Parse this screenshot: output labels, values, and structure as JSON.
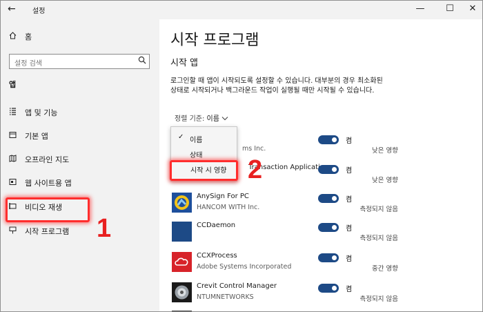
{
  "window": {
    "title": "설정",
    "back_icon": "back-arrow-icon",
    "controls": [
      "minimize-icon",
      "maximize-icon",
      "close-icon"
    ],
    "min_glyph": "—",
    "max_glyph": "☐",
    "close_glyph": "✕",
    "back_glyph": "←"
  },
  "sidebar": {
    "home": "홈",
    "search_placeholder": "설정 검색",
    "section": "앱",
    "items": [
      {
        "label": "앱 및 기능",
        "icon": "apps-list-icon"
      },
      {
        "label": "기본 앱",
        "icon": "default-apps-icon"
      },
      {
        "label": "오프라인 지도",
        "icon": "offline-maps-icon"
      },
      {
        "label": "웹 사이트용 앱",
        "icon": "websites-apps-icon"
      },
      {
        "label": "비디오 재생",
        "icon": "video-playback-icon"
      },
      {
        "label": "시작 프로그램",
        "icon": "startup-icon"
      }
    ]
  },
  "annotations": {
    "step1": "1",
    "step2": "2",
    "highlight_color": "#ff2d2d"
  },
  "main": {
    "title": "시작 프로그램",
    "subtitle": "시작 앱",
    "description": "로그인할 때 앱이 시작되도록 설정할 수 있습니다. 대부분의 경우 최소화된 상태로 시작되거나 백그라운드 작업이 실행될 때만 시작될 수 있습니다.",
    "sort_label": "정렬 기준:",
    "sort_value": "이름",
    "sort_menu": [
      "이름",
      "상태",
      "시작 시 영향"
    ],
    "sort_checked": "이름",
    "apps": [
      {
        "name": "",
        "publisher": "ms Inc.",
        "state": "켬",
        "impact": "낮은 영향"
      },
      {
        "name": "Transaction Application",
        "publisher": "",
        "state": "켬",
        "impact": "낮은 영향"
      },
      {
        "name": "AnySign For PC",
        "publisher": "HANCOM WITH Inc.",
        "state": "켬",
        "impact": "측정되지 않음"
      },
      {
        "name": "CCDaemon",
        "publisher": "",
        "state": "켬",
        "impact": "측정되지 않음"
      },
      {
        "name": "CCXProcess",
        "publisher": "Adobe Systems Incorporated",
        "state": "켬",
        "impact": "중간 영향"
      },
      {
        "name": "Crevit Control Manager",
        "publisher": "NTUMNETWORKS",
        "state": "켬",
        "impact": "측정되지 않음"
      }
    ],
    "toggle_color": "#1d4a86"
  }
}
